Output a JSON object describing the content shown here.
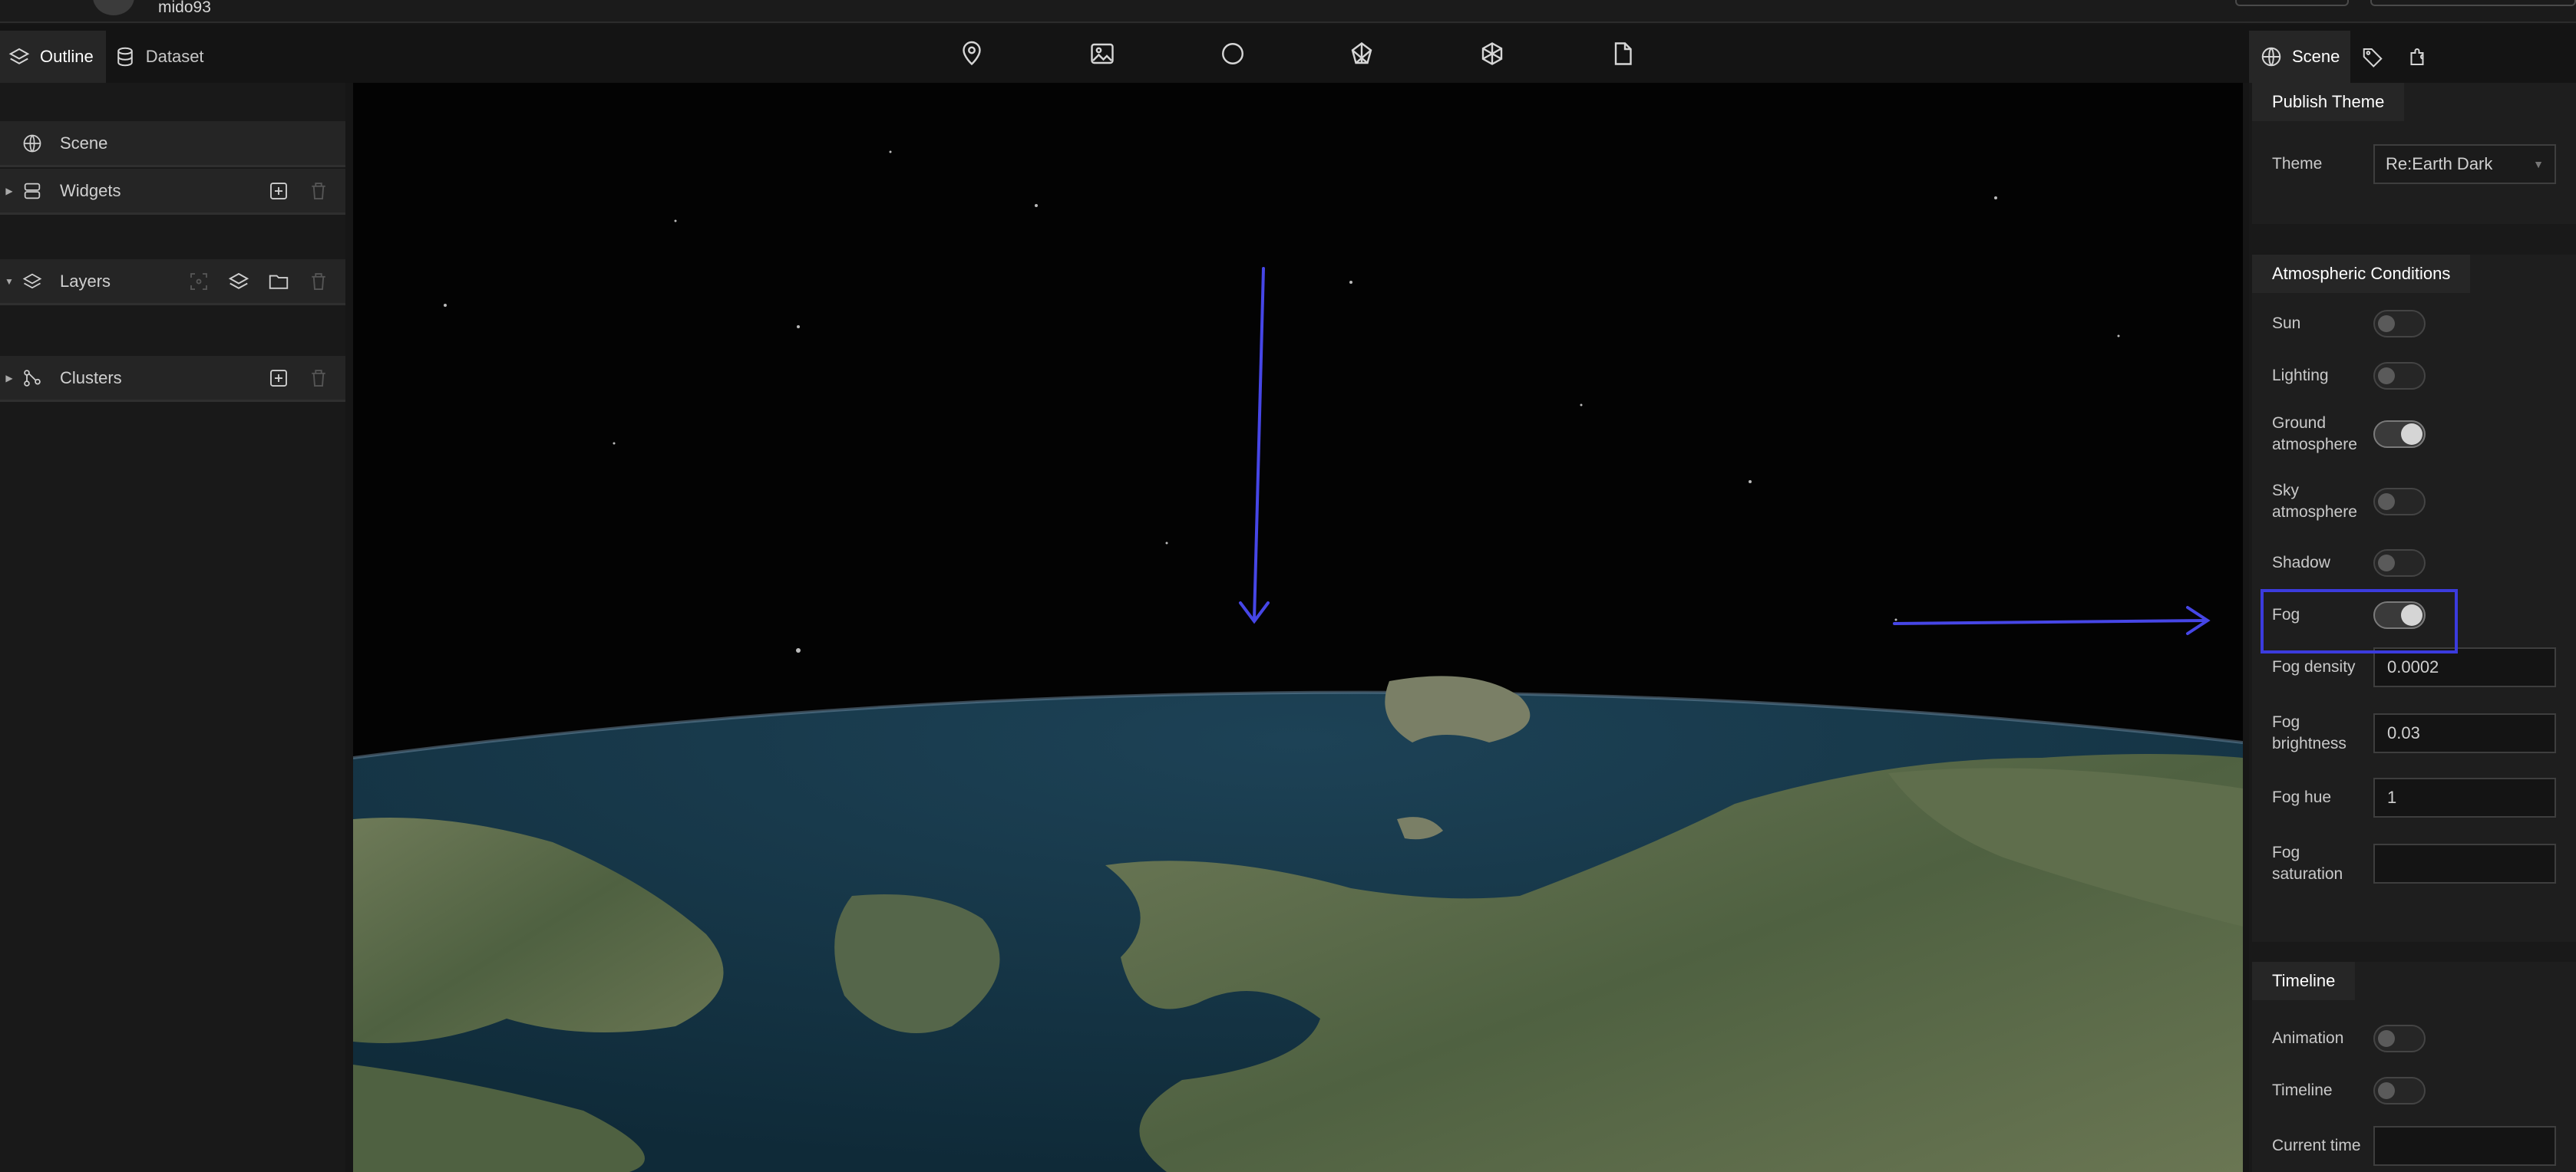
{
  "header": {
    "username": "mido93"
  },
  "toolbar": {
    "icons": [
      "map-pin-icon",
      "image-icon",
      "circle-icon",
      "polygon-icon",
      "model-icon",
      "document-icon"
    ]
  },
  "left_tabs": [
    {
      "label": "Outline"
    },
    {
      "label": "Dataset"
    }
  ],
  "outline": {
    "scene": "Scene",
    "widgets": "Widgets",
    "layers": "Layers",
    "clusters": "Clusters"
  },
  "right_tabs": [
    {
      "label": "Scene"
    }
  ],
  "publish_theme": {
    "title": "Publish Theme",
    "theme_label": "Theme",
    "theme_value": "Re:Earth Dark"
  },
  "atmosphere": {
    "title": "Atmospheric Conditions",
    "sun": {
      "label": "Sun",
      "on": false
    },
    "lighting": {
      "label": "Lighting",
      "on": false
    },
    "ground_atmosphere": {
      "label": "Ground atmosphere",
      "on": true
    },
    "sky_atmosphere": {
      "label": "Sky atmosphere",
      "on": false
    },
    "shadow": {
      "label": "Shadow",
      "on": false
    },
    "fog": {
      "label": "Fog",
      "on": true
    },
    "fog_density": {
      "label": "Fog density",
      "value": "0.0002"
    },
    "fog_brightness": {
      "label": "Fog brightness",
      "value": "0.03"
    },
    "fog_hue": {
      "label": "Fog hue",
      "value": "1"
    },
    "fog_saturation": {
      "label": "Fog saturation",
      "value": ""
    }
  },
  "timeline": {
    "title": "Timeline",
    "animation": {
      "label": "Animation",
      "on": false
    },
    "timeline": {
      "label": "Timeline",
      "on": false
    },
    "current_time": {
      "label": "Current time",
      "value": ""
    }
  },
  "colors": {
    "accent": "#3b3bdd",
    "panel": "#191919",
    "ocean": "#163446",
    "land": "#5d6d47"
  }
}
